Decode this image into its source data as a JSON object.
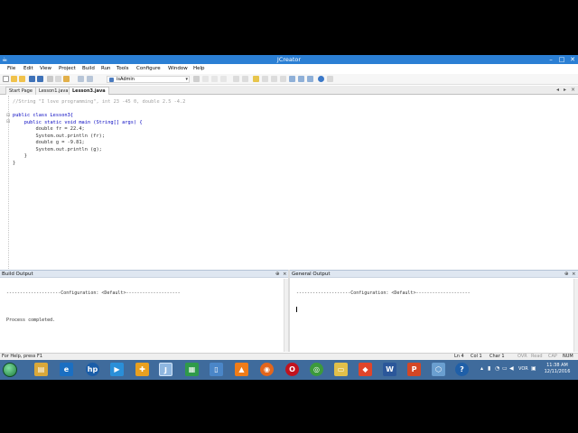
{
  "window": {
    "title": "JCreator",
    "minimize": "–",
    "maximize": "□",
    "close": "✕"
  },
  "menu": [
    "File",
    "Edit",
    "View",
    "Project",
    "Build",
    "Run",
    "Tools",
    "Configure",
    "Window",
    "Help"
  ],
  "toolbar": {
    "configuration": "isAdmin"
  },
  "tabs": [
    "Start Page",
    "Lesson1.java",
    "Lesson3.java"
  ],
  "active_tab": "Lesson3.java",
  "editor": {
    "lines": [
      "//String \"I love programming\", int 23 -45 0, double 2.5 -4.2",
      "",
      "public class Lesson3{",
      "    public static void main (String[] args) {",
      "        double fr = 22.4;",
      "        System.out.println (fr);",
      "        double g = -9.81;",
      "        System.out.println (g);",
      "    }",
      "}"
    ]
  },
  "build_output": {
    "title": "Build Output",
    "lines": [
      "--------------------Configuration: <Default>--------------------",
      "",
      "Process completed."
    ]
  },
  "general_output": {
    "title": "General Output",
    "lines": [
      "--------------------Configuration: <Default>--------------------"
    ]
  },
  "status": {
    "help": "For Help, press F1",
    "ln": "Ln 4",
    "col": "Col 1",
    "char": "Char 1",
    "ovr": "OVR",
    "read": "Read",
    "cap": "CAP",
    "num": "NUM"
  },
  "taskbar": {
    "lang": "VOR",
    "time": "11:38 AM",
    "date": "12/11/2016"
  }
}
